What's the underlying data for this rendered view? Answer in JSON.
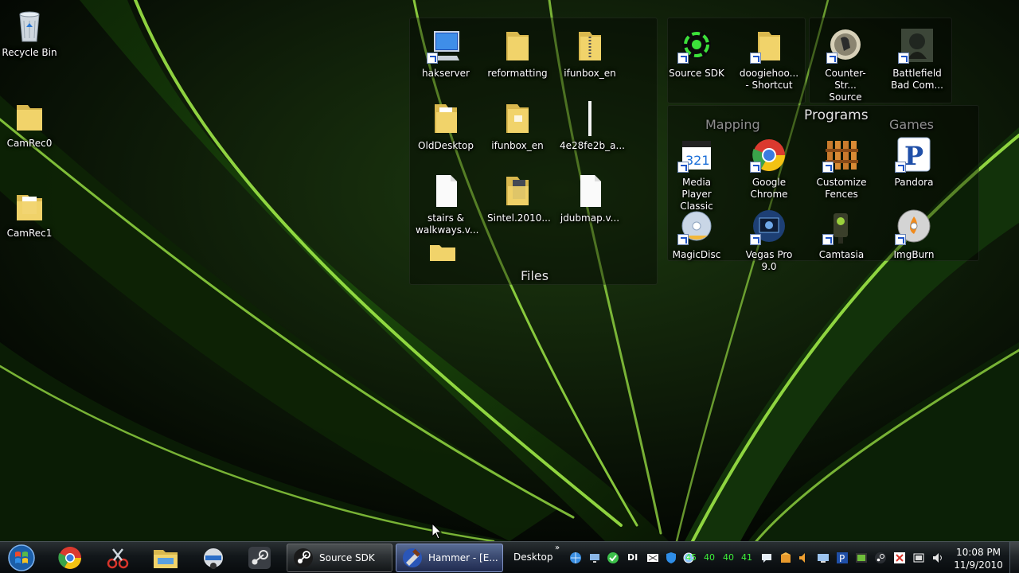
{
  "desktop": {
    "icons": [
      {
        "label": "Recycle Bin",
        "icon": "recycle-bin-icon"
      },
      {
        "label": "CamRec0",
        "icon": "folder-icon"
      },
      {
        "label": "CamRec1",
        "icon": "folder-icon"
      }
    ]
  },
  "fences": {
    "files": {
      "title": "Files",
      "items": [
        {
          "label": "hakserver",
          "icon": "computer-shortcut-icon"
        },
        {
          "label": "reformatting",
          "icon": "folder-icon"
        },
        {
          "label": "ifunbox_en",
          "icon": "zip-folder-icon"
        },
        {
          "label": "OldDesktop",
          "icon": "folder-icon"
        },
        {
          "label": "ifunbox_en",
          "icon": "folder-icon"
        },
        {
          "label": "4e28fe2b_a...",
          "icon": "file-icon"
        },
        {
          "label": "stairs &",
          "label2": "walkways.v...",
          "icon": "file-icon"
        },
        {
          "label": "Sintel.2010...",
          "icon": "folder-icon"
        },
        {
          "label": "jdubmap.v...",
          "icon": "file-icon"
        }
      ]
    },
    "mapping": {
      "title": "Mapping",
      "items": [
        {
          "label": "Source SDK",
          "icon": "source-sdk-icon"
        },
        {
          "label": "doogiehoo...",
          "label2": "- Shortcut",
          "icon": "folder-icon"
        }
      ]
    },
    "games": {
      "title": "Games",
      "items": [
        {
          "label": "Counter-Str...",
          "label2": "Source",
          "icon": "counter-strike-icon"
        },
        {
          "label": "Battlefield",
          "label2": "Bad Com...",
          "icon": "battlefield-icon"
        }
      ]
    },
    "programs": {
      "title": "Programs",
      "items": [
        {
          "label": "Media Player",
          "label2": "Classic",
          "icon": "media-player-classic-icon"
        },
        {
          "label": "Google",
          "label2": "Chrome",
          "icon": "chrome-icon"
        },
        {
          "label": "Customize",
          "label2": "Fences",
          "icon": "fences-icon"
        },
        {
          "label": "Pandora",
          "icon": "pandora-icon"
        },
        {
          "label": "MagicDisc",
          "icon": "magicdisc-icon"
        },
        {
          "label": "Vegas Pro 9.0",
          "icon": "vegas-icon"
        },
        {
          "label": "Camtasia",
          "icon": "camtasia-icon"
        },
        {
          "label": "ImgBurn",
          "icon": "imgburn-icon"
        }
      ]
    }
  },
  "taskbar": {
    "pinned": [
      "chrome-icon",
      "snipping-tool-icon",
      "explorer-icon",
      "steam-helmet-icon",
      "steam-icon"
    ],
    "tasks": [
      {
        "label": "Source SDK",
        "icon": "steam-icon",
        "active": false
      },
      {
        "label": "Hammer - [E...",
        "icon": "hammer-icon",
        "active": true
      }
    ],
    "toolbar_label": "Desktop",
    "toolbar_chevron": "»",
    "tray_numbers": [
      "45",
      "40",
      "40",
      "41"
    ],
    "clock": {
      "time": "10:08 PM",
      "date": "11/9/2010"
    }
  },
  "colors": {
    "accent_green": "#3ef03a",
    "taskbar_dark": "#0b0f11",
    "folder_yellow": "#f1d36a"
  }
}
